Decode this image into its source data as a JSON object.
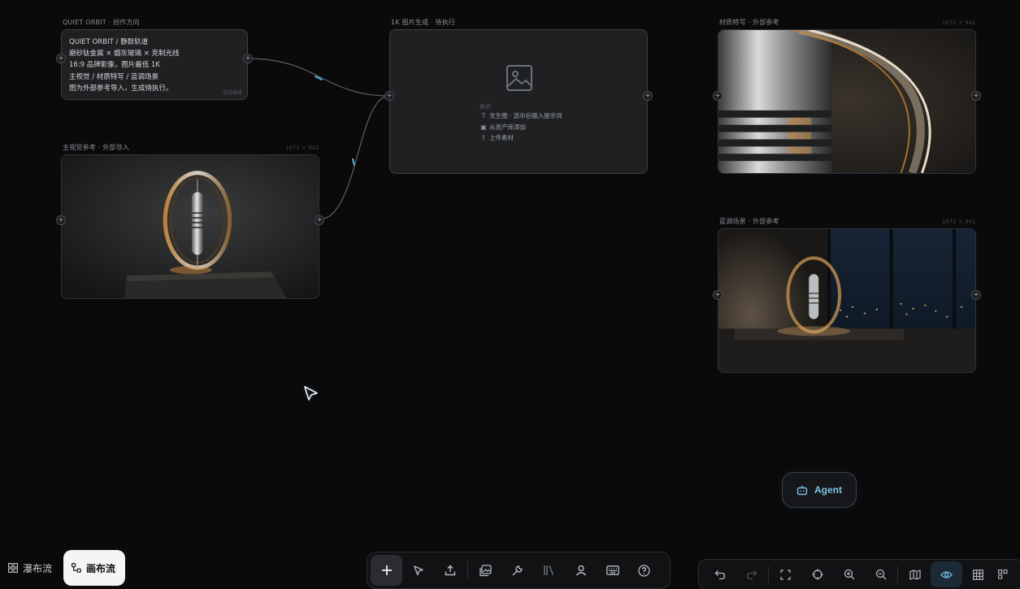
{
  "nodes": {
    "brief": {
      "title": "QUIET ORBIT · 创作方向",
      "lines": [
        "QUIET ORBIT / 静默轨道",
        "磨砂钛金属 × 烟灰玻璃 × 克制光线",
        "16:9 品牌影像，图片最低 1K",
        "主视觉 / 材质特写 / 蓝调场景",
        "图为外部参考导入，生成待执行。"
      ],
      "hint": "双击编辑"
    },
    "hero": {
      "title": "主视觉参考 · 外部导入",
      "dims": "1672 × 941"
    },
    "generator": {
      "title": "1K 图片生成 · 待执行",
      "try_label": "尝试：",
      "options": [
        {
          "icon": "text-icon",
          "label": "文生图 · 选中后输入提示词"
        },
        {
          "icon": "image-add-icon",
          "label": "从资产库添加"
        },
        {
          "icon": "upload-icon",
          "label": "上传素材"
        }
      ]
    },
    "material": {
      "title": "材质特写 · 外部参考",
      "dims": "1672 × 941"
    },
    "scene": {
      "title": "蓝调场景 · 外部参考",
      "dims": "1672 × 941"
    }
  },
  "agent": {
    "label": "Agent",
    "icon": "robot-icon"
  },
  "view_switch": [
    {
      "label": "瀑布流",
      "icon": "grid-icon",
      "active": false
    },
    {
      "label": "画布流",
      "icon": "flow-icon",
      "active": true
    }
  ],
  "toolbar": [
    "add-icon",
    "select-cursor-icon",
    "upload-icon",
    "image-gallery-icon",
    "wrench-icon",
    "library-icon",
    "user-icon",
    "keyboard-icon",
    "help-icon"
  ],
  "controls": [
    "undo-icon",
    "redo-icon",
    "fit-screen-icon",
    "locate-icon",
    "zoom-in-icon",
    "zoom-out-icon",
    "minimap-icon",
    "eye-icon",
    "grid-table-icon",
    "more-grid-icon"
  ],
  "colors": {
    "background": "#0a0a0b",
    "accent": "#6fb6e0",
    "card": "#1f2022"
  }
}
